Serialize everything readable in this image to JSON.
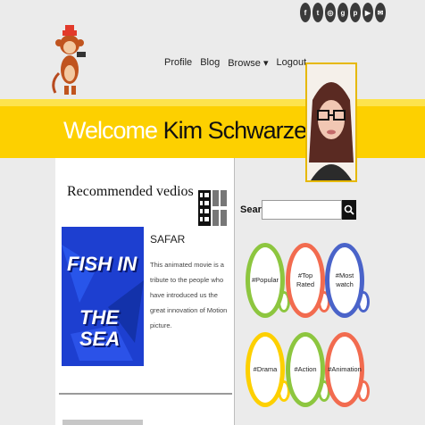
{
  "social": {
    "icons": [
      "facebook-icon",
      "twitter-icon",
      "instagram-icon",
      "google-plus-icon",
      "pinterest-icon",
      "youtube-icon",
      "email-icon"
    ],
    "glyphs": [
      "f",
      "t",
      "◎",
      "g",
      "p",
      "▶",
      "✉"
    ]
  },
  "nav": {
    "profile": "Profile",
    "blog": "Blog",
    "browse": "Browse ▾",
    "logout": "Logout"
  },
  "welcome": {
    "greeting": "Welcome",
    "name": "Kim Schwarzen"
  },
  "recommended": {
    "title": "Recommended vedios",
    "video": {
      "title": "SAFAR",
      "thumb_line1": "FISH IN",
      "thumb_line2": "THE SEA",
      "description": "This animated movie is a tribute to the people who have introduced us the great innovation of Motion picture."
    }
  },
  "search": {
    "label": "Search",
    "value": "",
    "placeholder": ""
  },
  "tags": [
    {
      "label": "#Popular",
      "color": "#8dc63f"
    },
    {
      "label": "#Top Rated",
      "color": "#f26b4f"
    },
    {
      "label": "#Most watch",
      "color": "#4a63c9"
    },
    {
      "label": "#Drama",
      "color": "#fdd000"
    },
    {
      "label": "#Action",
      "color": "#8dc63f"
    },
    {
      "label": "#Animation",
      "color": "#f26b4f"
    }
  ],
  "colors": {
    "accent": "#fdd000",
    "background": "#ebebeb"
  }
}
